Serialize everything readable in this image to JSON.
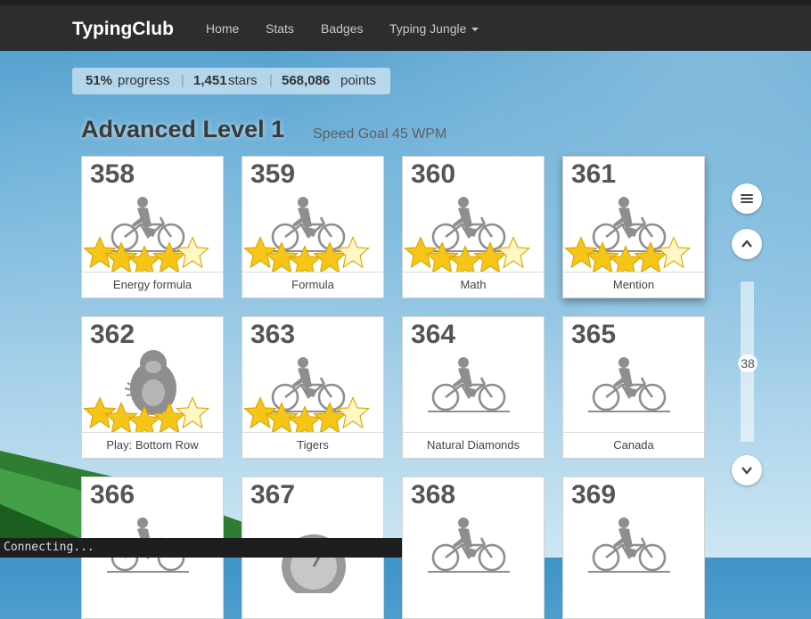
{
  "nav": {
    "brand": "TypingClub",
    "home": "Home",
    "stats": "Stats",
    "badges": "Badges",
    "jungle": "Typing Jungle"
  },
  "progress": {
    "percent": "51%",
    "percent_label": "progress",
    "stars": "1,451",
    "stars_label": "stars",
    "points": "568,086",
    "points_label": "points",
    "separator": "|"
  },
  "level": {
    "title": "Advanced Level 1",
    "subtitle": "Speed Goal 45 WPM"
  },
  "lessons": [
    {
      "num": "358",
      "label": "Energy formula",
      "icon": "bicycle-rider-icon",
      "stars": 5
    },
    {
      "num": "359",
      "label": "Formula",
      "icon": "bicycle-rider-icon",
      "stars": 5
    },
    {
      "num": "360",
      "label": "Math",
      "icon": "bicycle-rider-icon",
      "stars": 5
    },
    {
      "num": "361",
      "label": "Mention",
      "icon": "bicycle-rider-icon",
      "stars": 5
    },
    {
      "num": "362",
      "label": "Play: Bottom Row",
      "icon": "gorilla-icon",
      "stars": 5
    },
    {
      "num": "363",
      "label": "Tigers",
      "icon": "bicycle-rider-icon",
      "stars": 5
    },
    {
      "num": "364",
      "label": "Natural Diamonds",
      "icon": "bicycle-rider-icon",
      "stars": 0
    },
    {
      "num": "365",
      "label": "Canada",
      "icon": "bicycle-rider-icon",
      "stars": 0
    },
    {
      "num": "366",
      "label": "",
      "icon": "bicycle-rider-icon",
      "stars": 0
    },
    {
      "num": "367",
      "label": "",
      "icon": "stopwatch-icon",
      "stars": 0
    },
    {
      "num": "368",
      "label": "",
      "icon": "bicycle-rider-icon",
      "stars": 0
    },
    {
      "num": "369",
      "label": "",
      "icon": "bicycle-rider-icon",
      "stars": 0
    }
  ],
  "sidebar": {
    "scroll_value": "38"
  },
  "status": {
    "text": "Connecting..."
  },
  "colors": {
    "navbar": "#2d2d2d",
    "star_gold": "#f5c518",
    "sky": "#6fb2da"
  }
}
